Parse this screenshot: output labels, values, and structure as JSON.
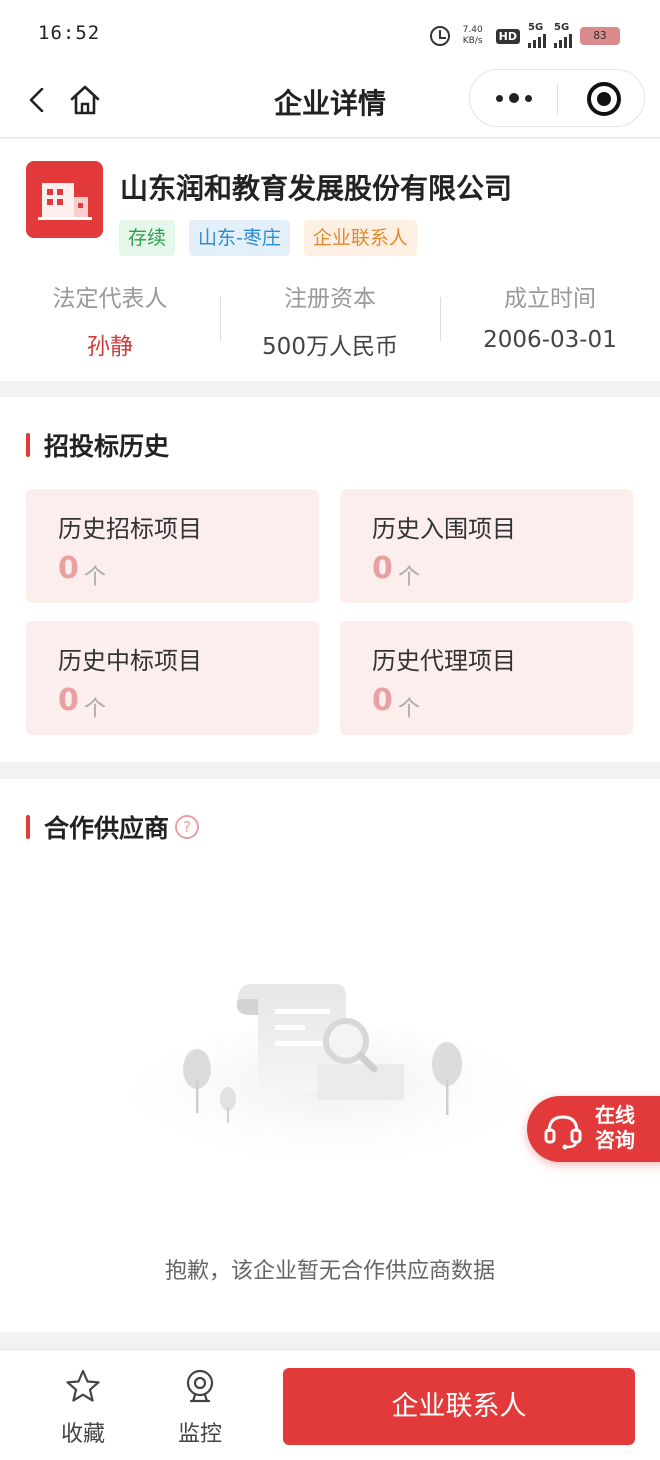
{
  "status_bar": {
    "time": "16:52",
    "net_speed_value": "7.40",
    "net_speed_unit": "KB/s",
    "hd_label": "HD",
    "sim1_label": "5G",
    "sim2_label": "5G",
    "battery": "83"
  },
  "nav": {
    "title": "企业详情"
  },
  "company": {
    "name": "山东润和教育发展股份有限公司",
    "tags": [
      "存续",
      "山东-枣庄",
      "企业联系人"
    ],
    "legal_rep_label": "法定代表人",
    "legal_rep_value": "孙静",
    "capital_label": "注册资本",
    "capital_value": "500万人民币",
    "founded_label": "成立时间",
    "founded_value": "2006-03-01"
  },
  "bidding": {
    "title": "招投标历史",
    "unit": "个",
    "stats": [
      {
        "label": "历史招标项目",
        "count": "0"
      },
      {
        "label": "历史入围项目",
        "count": "0"
      },
      {
        "label": "历史中标项目",
        "count": "0"
      },
      {
        "label": "历史代理项目",
        "count": "0"
      }
    ]
  },
  "partners": {
    "title": "合作供应商",
    "help_glyph": "?",
    "empty_text": "抱歉，该企业暂无合作供应商数据"
  },
  "consult": {
    "line1": "在线",
    "line2": "咨询"
  },
  "bottom_bar": {
    "favorite_label": "收藏",
    "monitor_label": "监控",
    "contact_button": "企业联系人"
  },
  "colors": {
    "brand_red": "#e23a3a",
    "stat_bg": "#fdeeee",
    "stat_count": "#e8a0a0"
  }
}
